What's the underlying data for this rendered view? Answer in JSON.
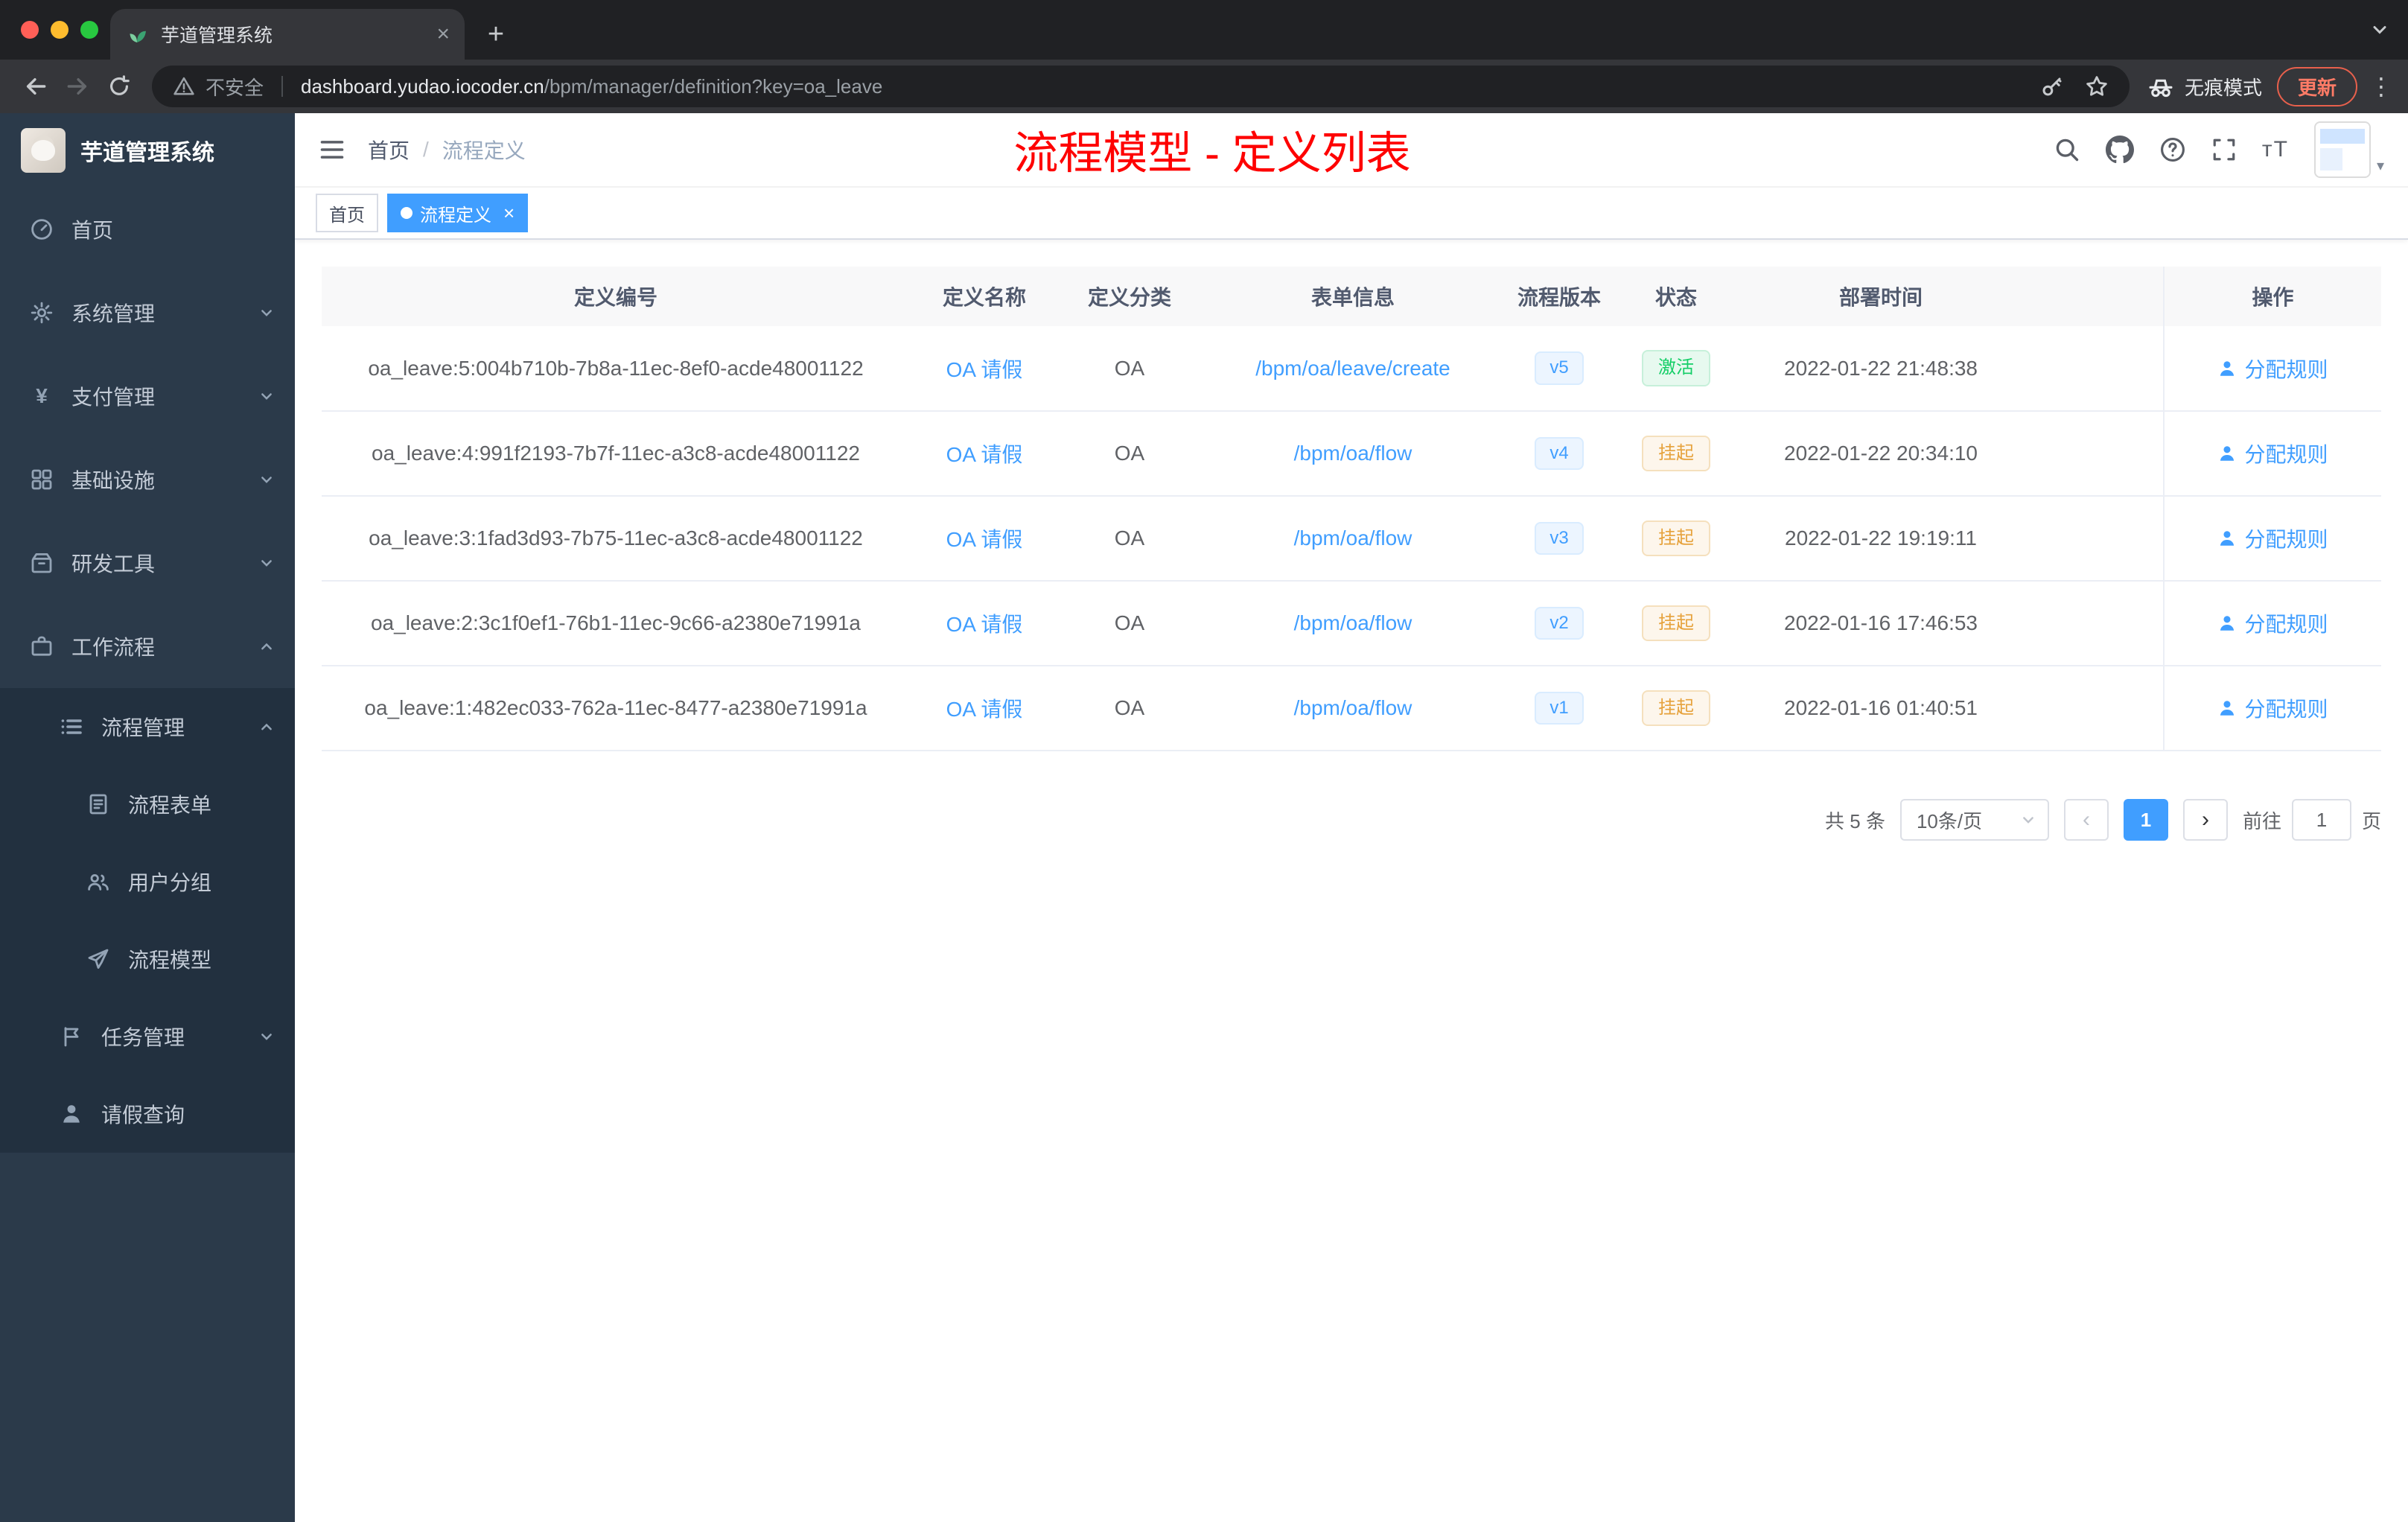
{
  "theme": {
    "accent_blue": "#409eff",
    "success_green": "#13ce66",
    "warning_orange": "#e6a23c",
    "annotation_red": "#fe0000",
    "sidebar_bg": "#2b3a4a",
    "submenu_bg": "#22303f",
    "chrome_dark": "#202124",
    "chrome_toolbar": "#35363a",
    "traffic_lights": [
      "#ff5f57",
      "#febc2e",
      "#28c840"
    ]
  },
  "browser": {
    "tab_title": "芋道管理系统",
    "close_tab": "×",
    "new_tab": "+",
    "security_label": "不安全",
    "url_host": "dashboard.yudao.iocoder.cn",
    "url_path": "/bpm/manager/definition?key=oa_leave",
    "incognito_label": "无痕模式",
    "update_label": "更新",
    "menu_dots": "⋮"
  },
  "sidebar": {
    "title": "芋道管理系统",
    "items": [
      {
        "label": "首页",
        "icon": "dashboard-icon",
        "level": 1
      },
      {
        "label": "系统管理",
        "icon": "gear-icon",
        "level": 1,
        "expanded": false
      },
      {
        "label": "支付管理",
        "icon": "yen-icon",
        "level": 1,
        "expanded": false
      },
      {
        "label": "基础设施",
        "icon": "grid-icon",
        "level": 1,
        "expanded": false
      },
      {
        "label": "研发工具",
        "icon": "toolbox-icon",
        "level": 1,
        "expanded": false
      },
      {
        "label": "工作流程",
        "icon": "briefcase-icon",
        "level": 1,
        "expanded": true
      },
      {
        "label": "流程管理",
        "icon": "list-icon",
        "level": 2,
        "expanded": true
      },
      {
        "label": "流程表单",
        "icon": "document-icon",
        "level": 3
      },
      {
        "label": "用户分组",
        "icon": "users-icon",
        "level": 3
      },
      {
        "label": "流程模型",
        "icon": "paper-plane-icon",
        "level": 3
      },
      {
        "label": "任务管理",
        "icon": "flag-icon",
        "level": 2,
        "expanded": false
      },
      {
        "label": "请假查询",
        "icon": "person-icon",
        "level": 2
      }
    ]
  },
  "navbar": {
    "breadcrumb_home": "首页",
    "breadcrumb_separator": "/",
    "breadcrumb_current": "流程定义",
    "annotation": "流程模型 - 定义列表"
  },
  "tags": {
    "home": "首页",
    "active": "流程定义",
    "close": "×"
  },
  "table": {
    "headers": {
      "id": "定义编号",
      "name": "定义名称",
      "category": "定义分类",
      "form": "表单信息",
      "version": "流程版本",
      "status": "状态",
      "deploy_time": "部署时间",
      "action": "操作"
    },
    "action_label": "分配规则",
    "rows": [
      {
        "id": "oa_leave:5:004b710b-7b8a-11ec-8ef0-acde48001122",
        "name": "OA 请假",
        "category": "OA",
        "form": "/bpm/oa/leave/create",
        "version": "v5",
        "status": "激活",
        "status_type": "success",
        "deploy_time": "2022-01-22 21:48:38"
      },
      {
        "id": "oa_leave:4:991f2193-7b7f-11ec-a3c8-acde48001122",
        "name": "OA 请假",
        "category": "OA",
        "form": "/bpm/oa/flow",
        "version": "v4",
        "status": "挂起",
        "status_type": "warning",
        "deploy_time": "2022-01-22 20:34:10"
      },
      {
        "id": "oa_leave:3:1fad3d93-7b75-11ec-a3c8-acde48001122",
        "name": "OA 请假",
        "category": "OA",
        "form": "/bpm/oa/flow",
        "version": "v3",
        "status": "挂起",
        "status_type": "warning",
        "deploy_time": "2022-01-22 19:19:11"
      },
      {
        "id": "oa_leave:2:3c1f0ef1-76b1-11ec-9c66-a2380e71991a",
        "name": "OA 请假",
        "category": "OA",
        "form": "/bpm/oa/flow",
        "version": "v2",
        "status": "挂起",
        "status_type": "warning",
        "deploy_time": "2022-01-16 17:46:53"
      },
      {
        "id": "oa_leave:1:482ec033-762a-11ec-8477-a2380e71991a",
        "name": "OA 请假",
        "category": "OA",
        "form": "/bpm/oa/flow",
        "version": "v1",
        "status": "挂起",
        "status_type": "warning",
        "deploy_time": "2022-01-16 01:40:51"
      }
    ]
  },
  "pagination": {
    "total": "共 5 条",
    "page_size": "10条/页",
    "prev": "‹",
    "page": "1",
    "next": "›",
    "goto_label": "前往",
    "goto_value": "1",
    "page_unit": "页"
  }
}
